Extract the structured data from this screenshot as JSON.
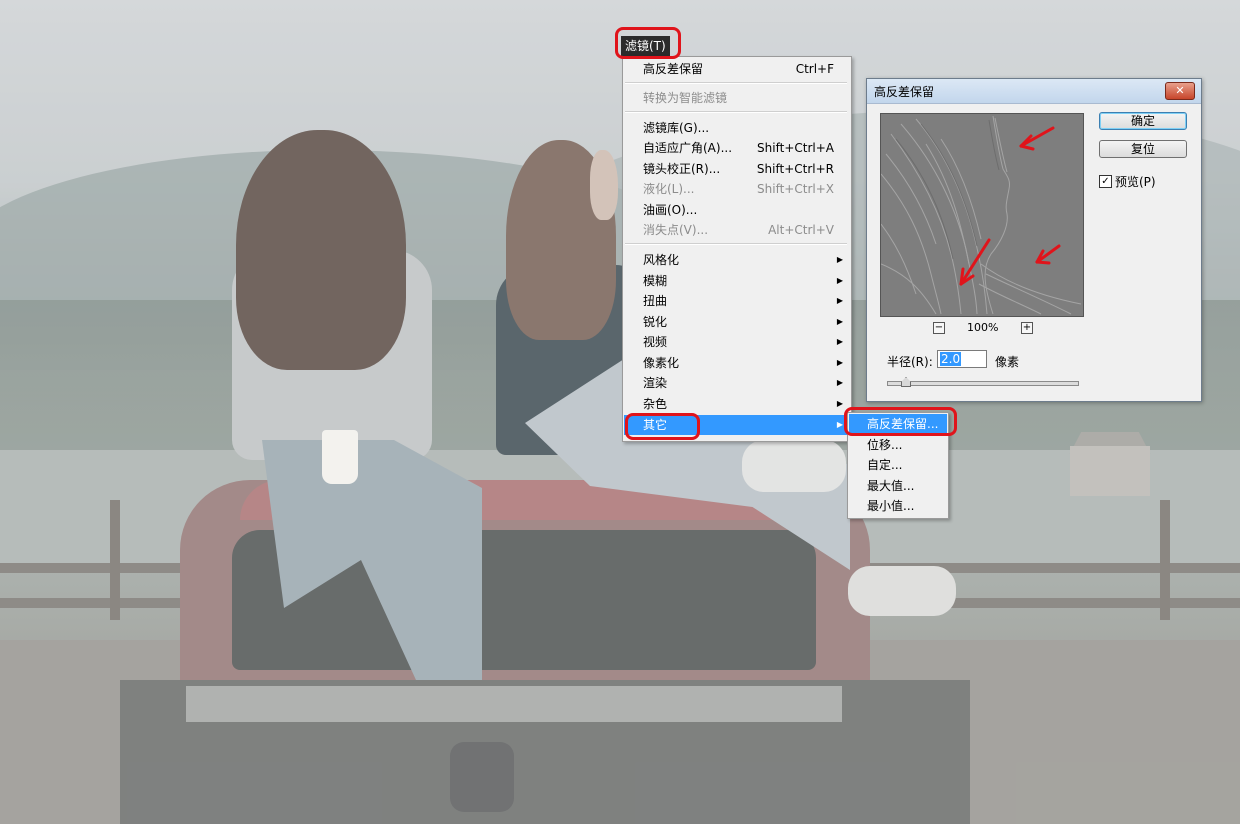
{
  "menubar": {
    "filter_menu_title": "滤镜(T)"
  },
  "filter_menu": {
    "last_filter": {
      "label": "高反差保留",
      "shortcut": "Ctrl+F"
    },
    "convert_smart": {
      "label": "转换为智能滤镜"
    },
    "gallery": {
      "label": "滤镜库(G)..."
    },
    "adaptive_wide": {
      "label": "自适应广角(A)...",
      "shortcut": "Shift+Ctrl+A"
    },
    "lens_correction": {
      "label": "镜头校正(R)...",
      "shortcut": "Shift+Ctrl+R"
    },
    "liquify": {
      "label": "液化(L)...",
      "shortcut": "Shift+Ctrl+X"
    },
    "oil_paint": {
      "label": "油画(O)..."
    },
    "vanishing_point": {
      "label": "消失点(V)...",
      "shortcut": "Alt+Ctrl+V"
    },
    "stylize": {
      "label": "风格化"
    },
    "blur": {
      "label": "模糊"
    },
    "distort": {
      "label": "扭曲"
    },
    "sharpen": {
      "label": "锐化"
    },
    "video": {
      "label": "视频"
    },
    "pixelate": {
      "label": "像素化"
    },
    "render": {
      "label": "渲染"
    },
    "noise": {
      "label": "杂色"
    },
    "other": {
      "label": "其它"
    }
  },
  "submenu_other": {
    "high_pass": "高反差保留...",
    "offset": "位移...",
    "custom": "自定...",
    "maximum": "最大值...",
    "minimum": "最小值..."
  },
  "dialog": {
    "title": "高反差保留",
    "close_glyph": "✕",
    "ok": "确定",
    "reset": "复位",
    "preview_label": "预览(P)",
    "preview_checked": "✓",
    "zoom_level": "100%",
    "zoom_out_glyph": "−",
    "zoom_in_glyph": "+",
    "radius_label": "半径(R):",
    "radius_value": "2.0",
    "radius_unit": "像素",
    "slider_value": 2.0
  },
  "colors": {
    "menu_highlight": "#3399ff",
    "annotation_red": "#e0141b"
  }
}
